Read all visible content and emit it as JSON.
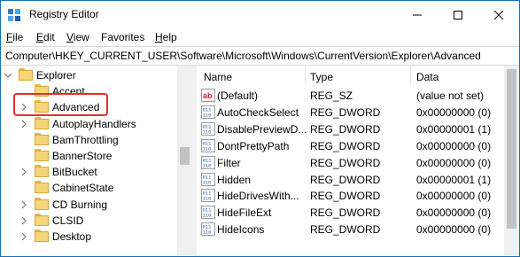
{
  "window": {
    "title": "Registry Editor",
    "minimize": "minimize",
    "maximize": "maximize",
    "close": "close"
  },
  "menu": [
    {
      "label": "File",
      "accel": "F",
      "rest": "ile"
    },
    {
      "label": "Edit",
      "accel": "E",
      "rest": "dit"
    },
    {
      "label": "View",
      "accel": "V",
      "rest": "iew"
    },
    {
      "label": "Favorites",
      "accel": "",
      "rest": "Favorites"
    },
    {
      "label": "Help",
      "accel": "H",
      "rest": "elp"
    }
  ],
  "address": "Computer\\HKEY_CURRENT_USER\\Software\\Microsoft\\Windows\\CurrentVersion\\Explorer\\Advanced",
  "tree": {
    "items": [
      {
        "label": "Explorer",
        "level": 0,
        "expander": "open"
      },
      {
        "label": "Accent",
        "level": 1,
        "expander": "none"
      },
      {
        "label": "Advanced",
        "level": 1,
        "expander": "closed",
        "selected": true
      },
      {
        "label": "AutoplayHandlers",
        "level": 1,
        "expander": "closed"
      },
      {
        "label": "BamThrottling",
        "level": 1,
        "expander": "none"
      },
      {
        "label": "BannerStore",
        "level": 1,
        "expander": "none"
      },
      {
        "label": "BitBucket",
        "level": 1,
        "expander": "closed"
      },
      {
        "label": "CabinetState",
        "level": 1,
        "expander": "none"
      },
      {
        "label": "CD Burning",
        "level": 1,
        "expander": "closed"
      },
      {
        "label": "CLSID",
        "level": 1,
        "expander": "closed"
      },
      {
        "label": "Desktop",
        "level": 1,
        "expander": "closed"
      }
    ]
  },
  "list": {
    "headers": {
      "name": "Name",
      "type": "Type",
      "data": "Data"
    },
    "rows": [
      {
        "icon": "string-value-icon",
        "name": "(Default)",
        "type": "REG_SZ",
        "data": "(value not set)"
      },
      {
        "icon": "binary-value-icon",
        "name": "AutoCheckSelect",
        "type": "REG_DWORD",
        "data": "0x00000000 (0)"
      },
      {
        "icon": "binary-value-icon",
        "name": "DisablePreviewD...",
        "type": "REG_DWORD",
        "data": "0x00000001 (1)"
      },
      {
        "icon": "binary-value-icon",
        "name": "DontPrettyPath",
        "type": "REG_DWORD",
        "data": "0x00000000 (0)"
      },
      {
        "icon": "binary-value-icon",
        "name": "Filter",
        "type": "REG_DWORD",
        "data": "0x00000000 (0)"
      },
      {
        "icon": "binary-value-icon",
        "name": "Hidden",
        "type": "REG_DWORD",
        "data": "0x00000001 (1)"
      },
      {
        "icon": "binary-value-icon",
        "name": "HideDrivesWith...",
        "type": "REG_DWORD",
        "data": "0x00000000 (0)"
      },
      {
        "icon": "binary-value-icon",
        "name": "HideFileExt",
        "type": "REG_DWORD",
        "data": "0x00000000 (0)"
      },
      {
        "icon": "binary-value-icon",
        "name": "HideIcons",
        "type": "REG_DWORD",
        "data": "0x00000000 (0)"
      }
    ]
  },
  "colors": {
    "highlight": "#e0312b",
    "folder": "#f5d57a",
    "dword_icon": "#1c5fb0",
    "string_icon": "#c1272d"
  }
}
